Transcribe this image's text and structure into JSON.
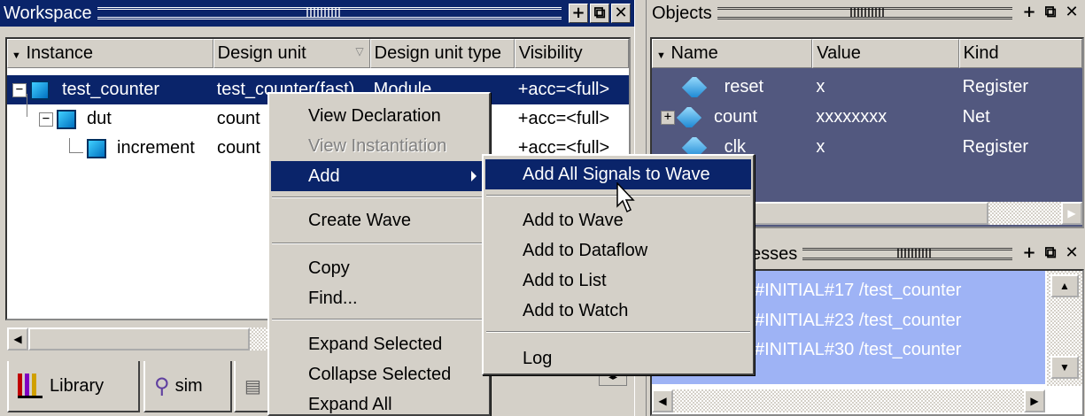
{
  "workspace": {
    "title": "Workspace",
    "columns": [
      "Instance",
      "Design unit",
      "Design unit type",
      "Visibility"
    ],
    "rows": [
      {
        "instance": "test_counter",
        "design_unit": "test_counter(fast)",
        "type": "Module",
        "visibility": "+acc=<full>",
        "expander": "−"
      },
      {
        "instance": "dut",
        "design_unit": "count",
        "type": "",
        "visibility": "+acc=<full>",
        "expander": "−"
      },
      {
        "instance": "increment",
        "design_unit": "count",
        "type": "",
        "visibility": "+acc=<full>",
        "expander": ""
      }
    ],
    "tabs": [
      {
        "label": "Library"
      },
      {
        "label": "sim"
      },
      {
        "label": ""
      }
    ],
    "buttons": {
      "dock": "+",
      "undock": "⧉",
      "close": "✕"
    }
  },
  "context_menu": {
    "items": [
      {
        "label": "View Declaration",
        "state": "normal"
      },
      {
        "label": "View Instantiation",
        "state": "disabled"
      },
      {
        "label": "Add",
        "state": "highlighted",
        "submenu": true
      },
      {
        "label": "Create Wave",
        "state": "normal"
      },
      {
        "label": "Copy",
        "state": "normal"
      },
      {
        "label": "Find...",
        "state": "normal"
      },
      {
        "label": "Expand Selected",
        "state": "normal"
      },
      {
        "label": "Collapse Selected",
        "state": "normal"
      },
      {
        "label": "Expand All",
        "state": "normal"
      }
    ]
  },
  "submenu": {
    "items": [
      {
        "label": "Add All Signals to Wave",
        "state": "highlighted"
      },
      {
        "label": "Add to Wave",
        "state": "normal"
      },
      {
        "label": "Add to Dataflow",
        "state": "normal"
      },
      {
        "label": "Add to List",
        "state": "normal"
      },
      {
        "label": "Add to Watch",
        "state": "normal"
      },
      {
        "label": "Log",
        "state": "normal"
      }
    ]
  },
  "objects": {
    "title": "Objects",
    "columns": [
      "Name",
      "Value",
      "Kind"
    ],
    "rows": [
      {
        "name": "reset",
        "value": "x",
        "kind": "Register",
        "expander": ""
      },
      {
        "name": "count",
        "value": "xxxxxxxx",
        "kind": "Net",
        "expander": "+"
      },
      {
        "name": "clk",
        "value": "x",
        "kind": "Register",
        "expander": ""
      }
    ]
  },
  "processes": {
    "title_visible": "esses",
    "rows": [
      {
        "text": "#INITIAL#17 /test_counter"
      },
      {
        "text": "#INITIAL#23 /test_counter"
      },
      {
        "text": "#INITIAL#30 /test_counter"
      }
    ]
  },
  "colors": {
    "selection": "#0a246a",
    "objects_bg": "#52587f",
    "processes_bg": "#9eb3f5"
  }
}
